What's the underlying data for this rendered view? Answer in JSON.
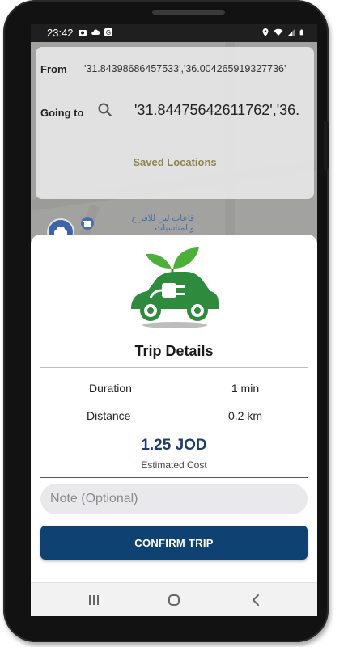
{
  "status_bar": {
    "time": "23:42",
    "left_icons": [
      "camera-icon",
      "cloud-icon",
      "g-app-icon"
    ],
    "right_icons": [
      "location-icon",
      "wifi-icon",
      "signal-icon",
      "battery-icon"
    ]
  },
  "search": {
    "from_label": "From",
    "from_value": "'31.84398686457533','36.004265919327736'",
    "going_to_label": "Going to",
    "going_to_value": "'31.84475642611762','36.",
    "saved_locations": "Saved Locations"
  },
  "map": {
    "place_name": "قاعات لين للافراح والمناسبات"
  },
  "trip": {
    "title": "Trip Details",
    "rows": [
      {
        "label": "Duration",
        "value": "1 min"
      },
      {
        "label": "Distance",
        "value": "0.2 km"
      }
    ],
    "cost": "1.25 JOD",
    "cost_label": "Estimated Cost",
    "note_placeholder": "Note (Optional)",
    "confirm_label": "CONFIRM TRIP"
  },
  "colors": {
    "primary": "#0f4273",
    "cost_text": "#1e3d6e",
    "logo_green": "#2e8b3e",
    "saved_link": "#8a8550"
  },
  "nav": [
    "recent-apps-icon",
    "home-icon",
    "back-icon"
  ]
}
